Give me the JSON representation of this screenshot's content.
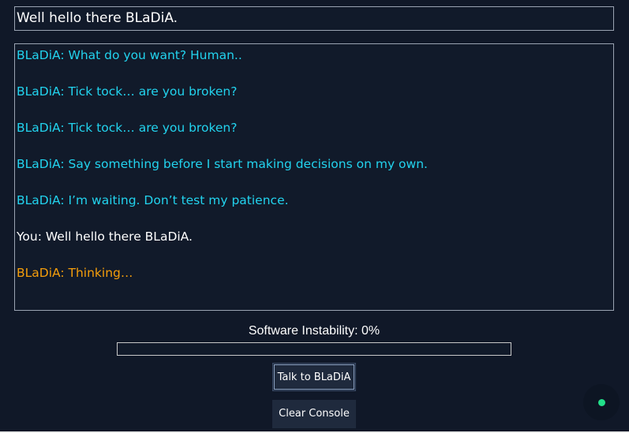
{
  "input": {
    "value": "Well hello there BLaDiA."
  },
  "console": {
    "messages": [
      {
        "speaker": "BLaDiA",
        "text": "BLaDiA: What do you want? Human.."
      },
      {
        "speaker": "BLaDiA",
        "text": "BLaDiA: Tick tock… are you broken?"
      },
      {
        "speaker": "BLaDiA",
        "text": "BLaDiA: Tick tock… are you broken?"
      },
      {
        "speaker": "BLaDiA",
        "text": "BLaDiA: Say something before I start making decisions on my own."
      },
      {
        "speaker": "BLaDiA",
        "text": "BLaDiA: I’m waiting. Don’t test my patience."
      },
      {
        "speaker": "You",
        "text": "You: Well hello there BLaDiA."
      },
      {
        "speaker": "BLaDiA",
        "text": "BLaDiA: Thinking…"
      }
    ]
  },
  "status": {
    "label": "Software Instability: 0%",
    "instability_percent": 0
  },
  "buttons": {
    "talk_label": "Talk to BLaDiA",
    "clear_label": "Clear Console"
  },
  "indicator": {
    "icon": "status-dot-icon",
    "color": "#22e08a"
  },
  "colors": {
    "background": "#101828",
    "bot_text": "#22d3ee",
    "user_text": "#ffffff",
    "thinking_text": "#f59e0b"
  }
}
